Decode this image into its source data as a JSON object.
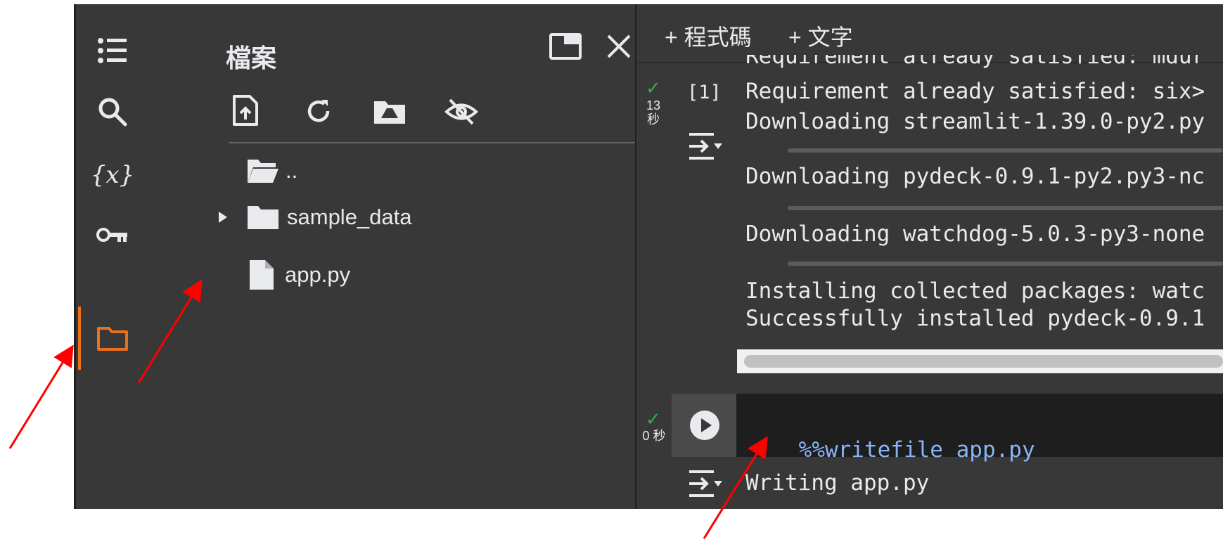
{
  "colors": {
    "background": "#383838",
    "accent_active": "#e8711a",
    "text": "#e8eaed",
    "magic_command": "#8ab4f8",
    "success_check": "#34a853",
    "annotation_arrow": "#ff0000"
  },
  "rail": {
    "items": [
      {
        "icon": "table-of-contents-icon"
      },
      {
        "icon": "search-icon"
      },
      {
        "icon": "variables-icon",
        "label": "{x}"
      },
      {
        "icon": "secrets-key-icon"
      },
      {
        "icon": "folder-icon",
        "active": true
      }
    ]
  },
  "files_panel": {
    "title": "檔案",
    "header_icons": [
      "open-in-tab-icon",
      "close-icon"
    ],
    "toolbar_icons": [
      "upload-file-icon",
      "refresh-icon",
      "mount-drive-icon",
      "hide-files-icon"
    ],
    "tree": [
      {
        "icon": "folder-open-icon",
        "label": ".."
      },
      {
        "icon": "folder-icon",
        "label": "sample_data",
        "expandable": true
      },
      {
        "icon": "file-icon",
        "label": "app.py"
      }
    ]
  },
  "notebook": {
    "toolbar": {
      "add_code": "+ 程式碼",
      "add_text": "+ 文字"
    },
    "cell1": {
      "exec_count": "[1]",
      "exec_time_value": "13",
      "exec_time_unit": "秒",
      "output_lines": [
        "Requirement already satisfied: mdur",
        "Requirement already satisfied: six>",
        "Downloading streamlit-1.39.0-py2.py",
        "Downloading pydeck-0.9.1-py2.py3-nc",
        "Downloading watchdog-5.0.3-py3-none",
        "Installing collected packages: watc",
        "Successfully installed pydeck-0.9.1"
      ]
    },
    "cell2": {
      "code_magic": "%%writefile",
      "code_arg": " app.py",
      "exec_time": "0 秒",
      "output": "Writing app.py"
    }
  }
}
